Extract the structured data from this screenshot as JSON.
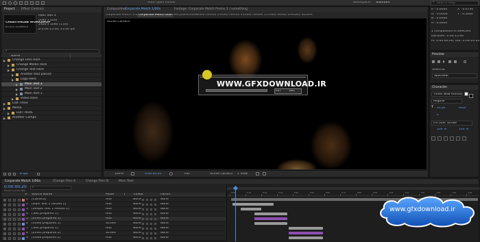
{
  "app": {
    "menu": [
      "Project",
      "Effect Controls",
      "Composition",
      "Layer",
      "Footage"
    ],
    "auto_open": "Auto-Open Panels",
    "workspace_label": "Workspace:",
    "workspace_value": "Standard",
    "search": "Search Help"
  },
  "project": {
    "tab": "Project",
    "tab2": "Effect Controls",
    "thumb_line1": "CREATIVELAB WORKSHOP",
    "thumb_line2": "ROTATE ELEMENTS",
    "info_lines": [
      "Main Text 3",
      "Used 1 time",
      "1920 x 1080 (1.00)",
      "Δ 0:00:15:00, 25.00 fps"
    ],
    "search_placeholder": "⌕",
    "col_name": "Name",
    "items": [
      {
        "label": "Change Files Here",
        "indent": 0
      },
      {
        "label": "Change Media Here",
        "indent": 1
      },
      {
        "label": "Change Text Here",
        "indent": 1
      },
      {
        "label": "Another text placed",
        "indent": 2
      },
      {
        "label": "Logo Here",
        "indent": 2
      },
      {
        "label": "Main Text 3",
        "indent": 3,
        "selected": true
      },
      {
        "label": "Main Text 2",
        "indent": 3
      },
      {
        "label": "Main Text 1",
        "indent": 3
      },
      {
        "label": "Video Here",
        "indent": 2
      },
      {
        "label": "Edit Timer",
        "indent": 0
      },
      {
        "label": "Media",
        "indent": 0
      },
      {
        "label": "EDIT HERE",
        "indent": 1
      },
      {
        "label": "Another Comps",
        "indent": 0
      }
    ],
    "bpc": "8 bpc"
  },
  "composition": {
    "tab_prefix": "Composition:",
    "tab_name": "Corporate Match 1/00a",
    "footage_tab": "Footage: Corporate Match Promo 1 / something",
    "breadcrumbs": [
      "Corporate Match 1/00a",
      "Corporate Match 00a",
      "Video placeholder",
      "Video nested 2",
      "Video nested 4",
      "Video nested 5",
      "Create Media 1",
      "MODEL SLIDER"
    ],
    "viewer_label": "Active Camera",
    "watermark": "WWW.GFXDOWNLOAD.IR",
    "sub_a": "lhfr",
    "sub_b": "b4c",
    "zoom": "100%",
    "timecode": "0:00:00:20",
    "resolution": "Full",
    "camera": "Active Camera",
    "view": "1 View"
  },
  "info": {
    "lines": [
      "R : 0.0000",
      "G : 0.0000",
      "B : 0.0000",
      "A : 0.0000"
    ],
    "pos": [
      "X : 0.0730",
      "Y : 0.5060"
    ],
    "note1": "1 composition is selected",
    "note2": "Duration: 0:00:15:00",
    "note3": "In: 0:00:00:00, Out: 0:00:14:24"
  },
  "preview": {
    "title": "Preview",
    "label": "Shortcut",
    "value": "Spacebar"
  },
  "character": {
    "title": "Character",
    "font": "Times New Roman",
    "style": "Regular",
    "size": "95 px",
    "leading": "Auto",
    "tracking": "0",
    "stroke": "Fill Over Stroke",
    "percent": "100 %"
  },
  "timeline": {
    "tabs": [
      "Corporate Match 1/00a",
      "Change Files A",
      "Change Files B",
      "Main Text"
    ],
    "timecode": "0:00:00:20",
    "frame": "00020 (25.00 fps)",
    "search": "⌕",
    "headers": [
      "#",
      "Source Name",
      "Mode",
      "T",
      "TrkMat",
      "Parent"
    ],
    "ticks": [
      "00s",
      "01s",
      "02s",
      "03s",
      "04s",
      "05s",
      "06s",
      "07s",
      "08s",
      "09s",
      "10s",
      "11s",
      "12s",
      "13s",
      "14s",
      "15s"
    ],
    "layers": [
      {
        "num": "1",
        "name": "[Camera]",
        "mode": "Add",
        "mat": "None",
        "parent": "None"
      },
      {
        "num": "2",
        "name": "[Main Text 1 nested 1]",
        "mode": "Add",
        "mat": "None",
        "parent": "None"
      },
      {
        "num": "3",
        "name": "[Simple Text 1 nested 1]",
        "mode": "Add",
        "mat": "None",
        "parent": "None"
      },
      {
        "num": "4",
        "name": "[Text prepared 1]",
        "mode": "Add",
        "mat": "None",
        "parent": "None"
      },
      {
        "num": "5",
        "name": "[Effect prepared 1]",
        "mode": "Add",
        "mat": "None",
        "parent": "None"
      },
      {
        "num": "6",
        "name": "[Video prepared 1]",
        "mode": "Screen",
        "mat": "None",
        "parent": "None"
      },
      {
        "num": "7",
        "name": "[Text prepared 2]",
        "mode": "Add",
        "mat": "None",
        "parent": "None"
      },
      {
        "num": "8",
        "name": "[Effect prepared 2]",
        "mode": "Screen",
        "mat": "None",
        "parent": "None"
      },
      {
        "num": "9",
        "name": "[Video prepared 2]",
        "mode": "Add",
        "mat": "None",
        "parent": "None"
      }
    ]
  },
  "banner": {
    "text": "www.gfxdownload.ir"
  },
  "colors": {
    "accent": "#4c8bd8",
    "label_purple": "#8e4fb0",
    "banner_blue": "#1b6fd6",
    "timecode": "#6aa7ff"
  }
}
